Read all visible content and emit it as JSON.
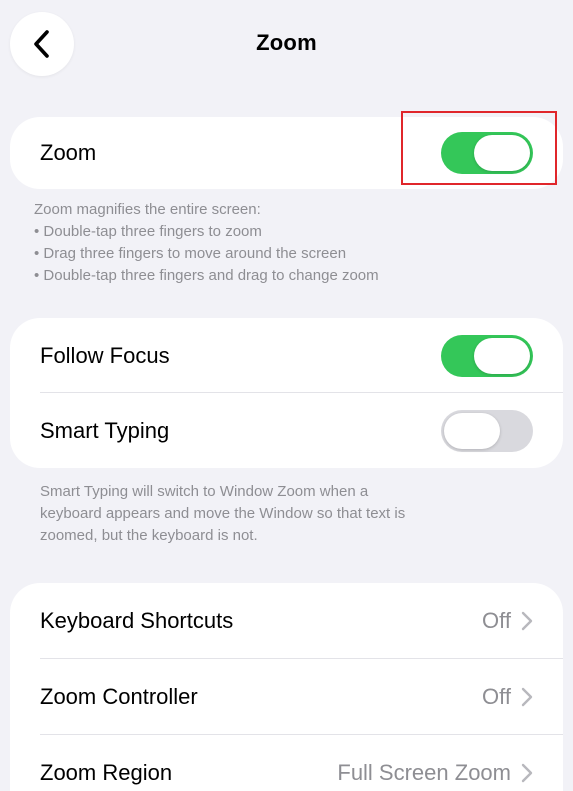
{
  "nav": {
    "title": "Zoom",
    "back_icon": "chevron-left-icon"
  },
  "zoom_group": {
    "label": "Zoom",
    "toggle_state": "on"
  },
  "zoom_description": {
    "heading": "Zoom magnifies the entire screen:",
    "bullets": [
      "• Double-tap three fingers to zoom",
      "• Drag three fingers to move around the screen",
      "• Double-tap three fingers and drag to change zoom"
    ]
  },
  "focus_group": {
    "follow_focus": {
      "label": "Follow Focus",
      "toggle_state": "on"
    },
    "smart_typing": {
      "label": "Smart Typing",
      "toggle_state": "off"
    }
  },
  "smart_typing_description": {
    "lines": [
      "Smart Typing will switch to Window Zoom when a",
      "keyboard appears and move the Window so that text is",
      "zoomed, but the keyboard is not."
    ]
  },
  "settings_group": {
    "items": [
      {
        "label": "Keyboard Shortcuts",
        "value": "Off"
      },
      {
        "label": "Zoom Controller",
        "value": "Off"
      },
      {
        "label": "Zoom Region",
        "value": "Full Screen Zoom"
      }
    ]
  },
  "colors": {
    "toggle_on": "#34c759",
    "toggle_off": "#d9d9de",
    "highlight": "#e0262b",
    "background": "#f2f2f7",
    "secondary_text": "#8e8e93"
  }
}
